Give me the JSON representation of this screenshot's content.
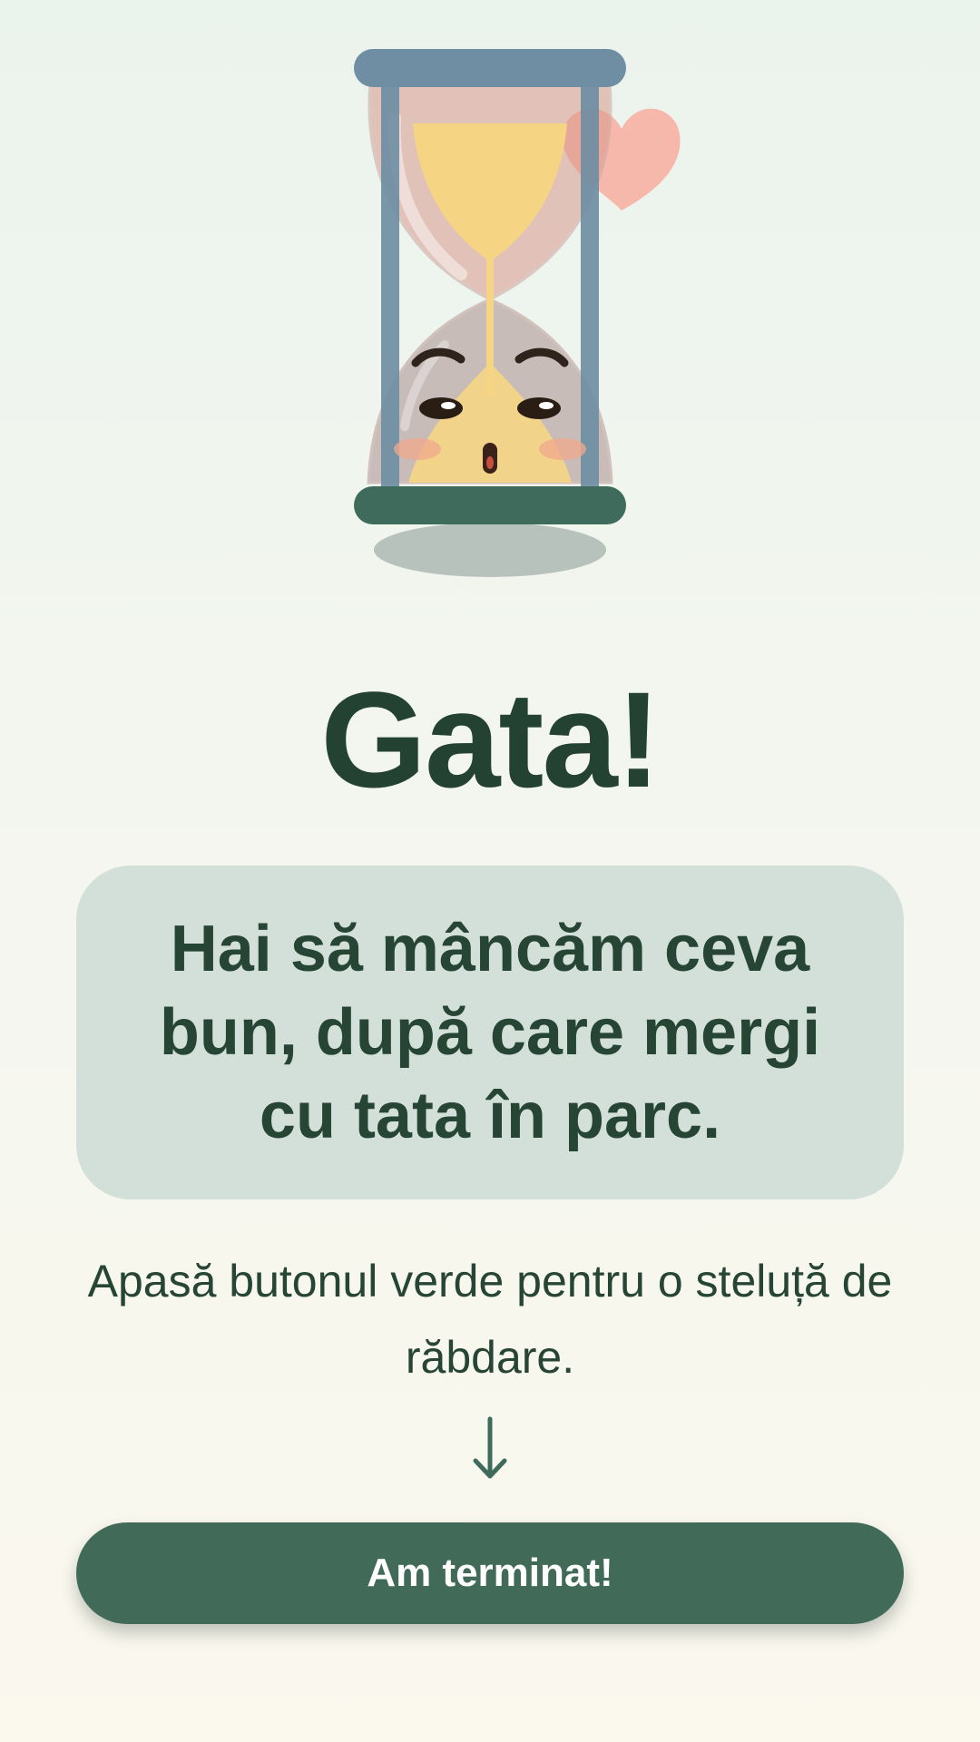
{
  "title": "Gata!",
  "message": "Hai să mâncăm ceva bun, după care mergi cu tata în parc.",
  "instruction": "Apasă butonul verde pentru o steluță de răbdare.",
  "done_button": {
    "label": "Am terminat!"
  },
  "illustration": {
    "icons": [
      "hourglass-icon",
      "heart-icon",
      "down-arrow-icon"
    ]
  },
  "colors": {
    "background_top": "#ebf3ed",
    "background_bottom": "#fbf8ee",
    "title": "#244232",
    "card_background": "#d3e0da",
    "button": "#416a58",
    "button_text": "#ffffff",
    "sand": "#f5d584",
    "frame": "#6f8ea3",
    "base": "#3f6b5c",
    "heart": "#f8b4a8"
  }
}
